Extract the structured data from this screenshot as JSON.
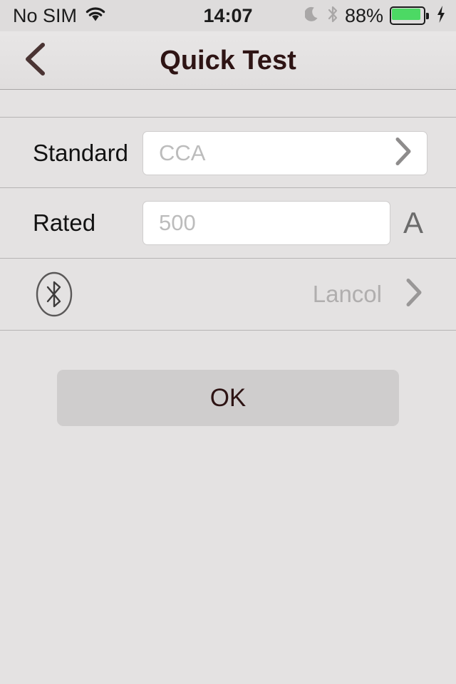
{
  "status_bar": {
    "carrier": "No SIM",
    "wifi_icon": "wifi-icon",
    "time": "14:07",
    "dnd_icon": "moon-icon",
    "bluetooth_icon": "bluetooth-icon",
    "battery_percent": "88%",
    "battery_level": 88,
    "battery_color": "#4cd964",
    "charging_icon": "lightning-bolt-icon"
  },
  "navbar": {
    "back_icon": "chevron-left-icon",
    "title": "Quick Test",
    "title_color": "#2e1414"
  },
  "form": {
    "rows": [
      {
        "label": "Standard",
        "value": "CCA",
        "placeholder": "CCA",
        "accessory_icon": "chevron-right-icon"
      },
      {
        "label": "Rated",
        "value": "500",
        "placeholder": "500",
        "unit": "A"
      },
      {
        "icon": "bluetooth-circle-icon",
        "device_name": "Lancol",
        "accessory_icon": "chevron-right-icon"
      }
    ]
  },
  "actions": {
    "ok_label": "OK"
  }
}
